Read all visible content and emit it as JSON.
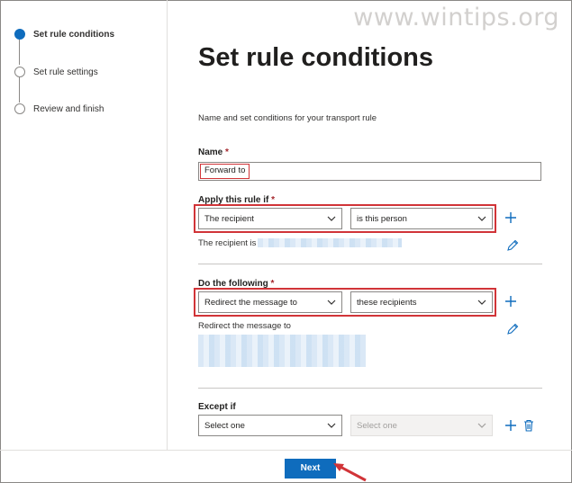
{
  "watermark": "www.wintips.org",
  "steps": [
    {
      "label": "Set rule conditions",
      "active": true
    },
    {
      "label": "Set rule settings",
      "active": false
    },
    {
      "label": "Review and finish",
      "active": false
    }
  ],
  "main": {
    "title": "Set rule conditions",
    "subtitle": "Name and set conditions for your transport rule"
  },
  "name_field": {
    "label": "Name",
    "required_mark": "*",
    "value": "Forward to"
  },
  "apply_if": {
    "label": "Apply this rule if",
    "required_mark": "*",
    "condition": "The recipient",
    "operator": "is this person",
    "summary": "The recipient is"
  },
  "do_following": {
    "label": "Do the following",
    "required_mark": "*",
    "action": "Redirect the message to",
    "target": "these recipients",
    "summary": "Redirect the message to"
  },
  "except_if": {
    "label": "Except if",
    "condition": "Select one",
    "operator": "Select one"
  },
  "footer": {
    "next_label": "Next"
  },
  "colors": {
    "accent": "#0f6cbd",
    "highlight": "#d13438"
  }
}
